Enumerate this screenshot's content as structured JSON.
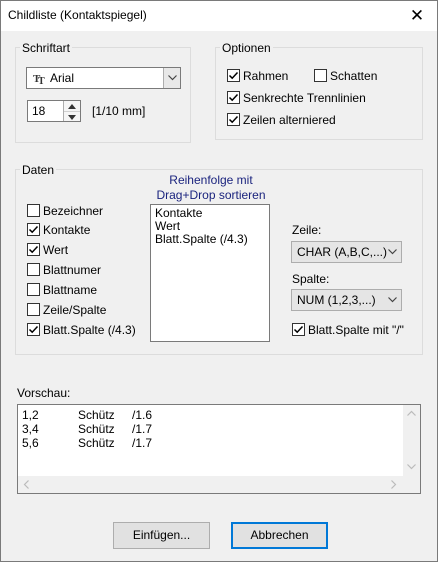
{
  "window": {
    "title": "Childliste (Kontaktspiegel)",
    "close_glyph": "✕"
  },
  "font_group": {
    "label": "Schriftart",
    "font_value": "Arial",
    "font_icon": "truetype-font-icon",
    "size_value": "18",
    "size_unit": "[1/10 mm]"
  },
  "options_group": {
    "label": "Optionen",
    "rahmen": {
      "label": "Rahmen",
      "checked": true
    },
    "schatten": {
      "label": "Schatten",
      "checked": false
    },
    "senkrechte": {
      "label": "Senkrechte Trennlinien",
      "checked": true
    },
    "zeilen_alt": {
      "label": "Zeilen alterniered",
      "checked": true
    }
  },
  "data_group": {
    "label": "Daten",
    "sort_note_line1": "Reihenfolge mit",
    "sort_note_line2": "Drag+Drop sortieren",
    "checkboxes": [
      {
        "label": "Bezeichner",
        "checked": false
      },
      {
        "label": "Kontakte",
        "checked": true
      },
      {
        "label": "Wert",
        "checked": true
      },
      {
        "label": "Blattnumer",
        "checked": false
      },
      {
        "label": "Blattname",
        "checked": false
      },
      {
        "label": "Zeile/Spalte",
        "checked": false
      },
      {
        "label": "Blatt.Spalte (/4.3)",
        "checked": true
      }
    ],
    "order_list": [
      "Kontakte",
      "Wert",
      "Blatt.Spalte (/4.3)"
    ],
    "zeile_label": "Zeile:",
    "zeile_value": "CHAR (A,B,C,...)",
    "spalte_label": "Spalte:",
    "spalte_value": "NUM (1,2,3,...)",
    "blatt_slash": {
      "label": "Blatt.Spalte mit \"/\"",
      "checked": true
    }
  },
  "preview": {
    "label": "Vorschau:",
    "rows": [
      {
        "a": "1,2",
        "b": "Schütz",
        "c": "/1.6"
      },
      {
        "a": "3,4",
        "b": "Schütz",
        "c": "/1.7"
      },
      {
        "a": "5,6",
        "b": "Schütz",
        "c": "/1.7"
      }
    ]
  },
  "buttons": {
    "insert": "Einfügen...",
    "cancel": "Abbrechen"
  },
  "colors": {
    "accent": "#0078d7",
    "sort_note": "#1a237e"
  }
}
